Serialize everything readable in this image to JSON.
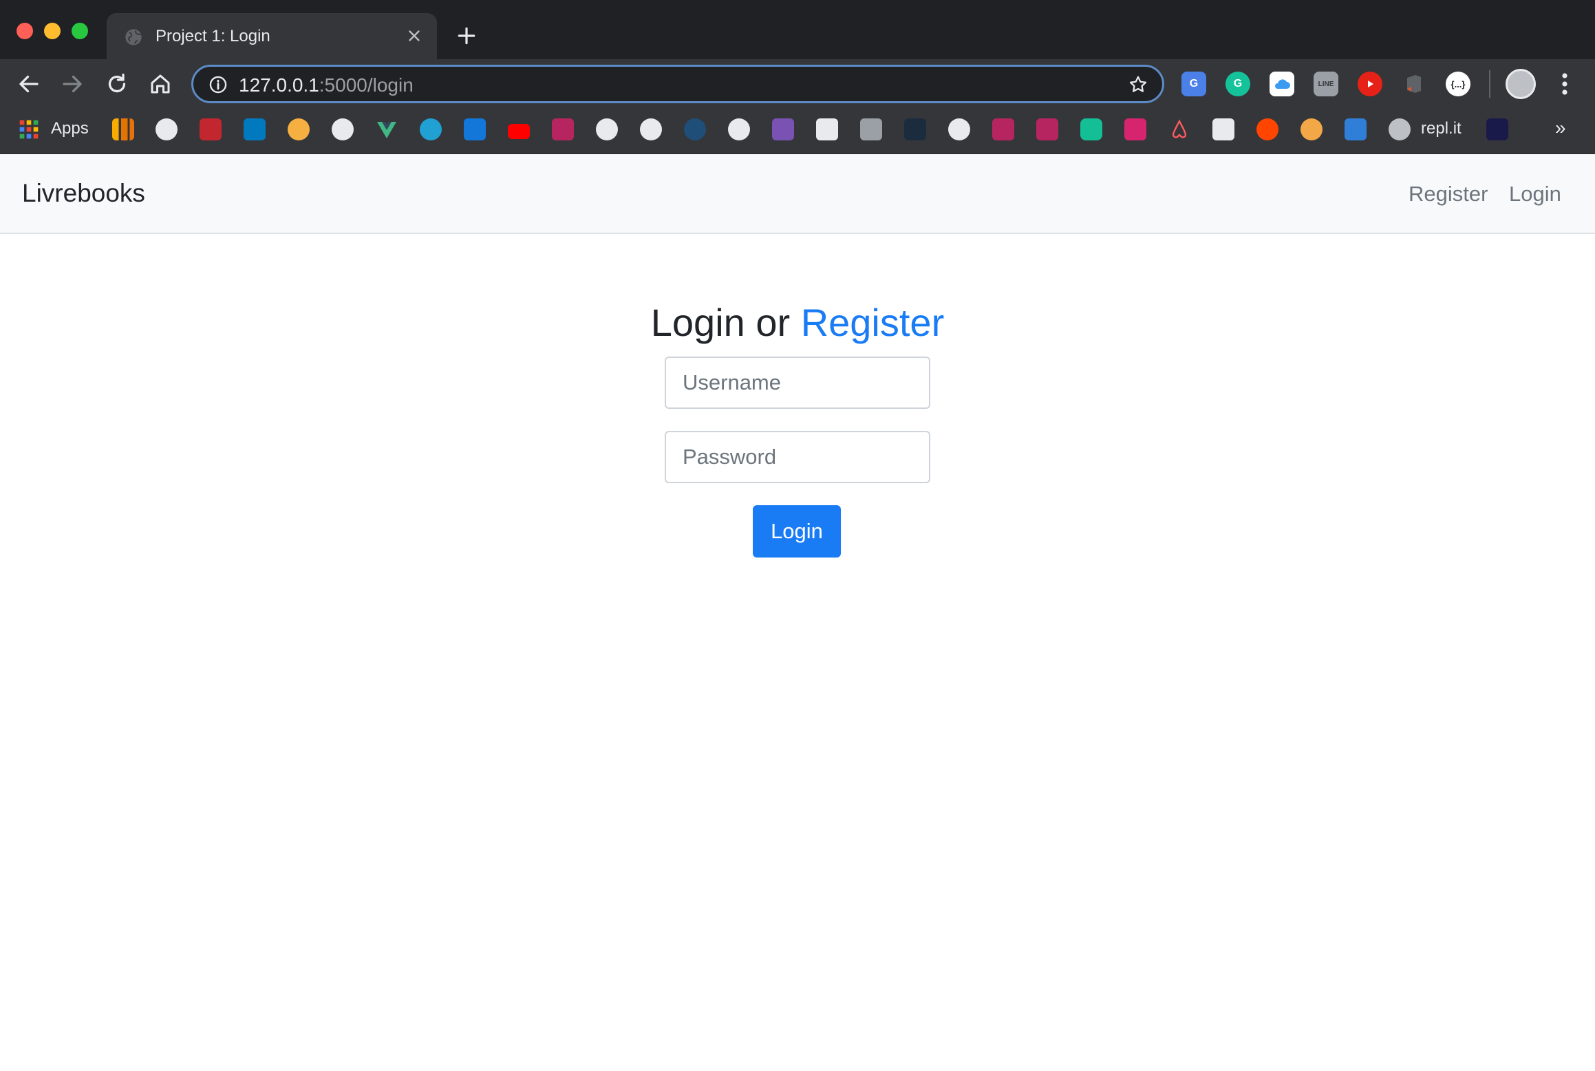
{
  "browser": {
    "tab_title": "Project 1: Login",
    "url_host": "127.0.0.1",
    "url_rest": ":5000/login",
    "bookmarks": {
      "apps_label": "Apps",
      "replit_label": "repl.it",
      "more_label": "»",
      "icons": [
        "analytics-icon",
        "globe-icon",
        "sololearn-icon",
        "trello-icon",
        "alarm-icon",
        "globe-icon",
        "vue-icon",
        "wordpress-icon",
        "vscode-icon",
        "youtube-icon",
        "edx-icon",
        "github-icon",
        "github-icon",
        "docker-icon",
        "globe-icon",
        "heroku-icon",
        "notion-icon",
        "abacus-icon",
        "pixel-icon",
        "globe-icon",
        "edx-icon",
        "edx-icon",
        "khan-academy-icon",
        "visual-studio-icon",
        "airbnb-icon",
        "book-icon",
        "reddit-icon",
        "ebay-icon",
        "cloud-upload-icon",
        "replit-icon",
        "thirty-seconds-icon"
      ]
    }
  },
  "navbar": {
    "brand": "Livrebooks",
    "register_link": "Register",
    "login_link": "Login"
  },
  "form": {
    "heading_prefix": "Login or",
    "heading_link": "Register",
    "username_placeholder": "Username",
    "password_placeholder": "Password",
    "submit_label": "Login"
  },
  "colors": {
    "primary": "#1a7cf5",
    "navbar_bg": "#f8f9fa",
    "chrome_bg": "#202124"
  }
}
